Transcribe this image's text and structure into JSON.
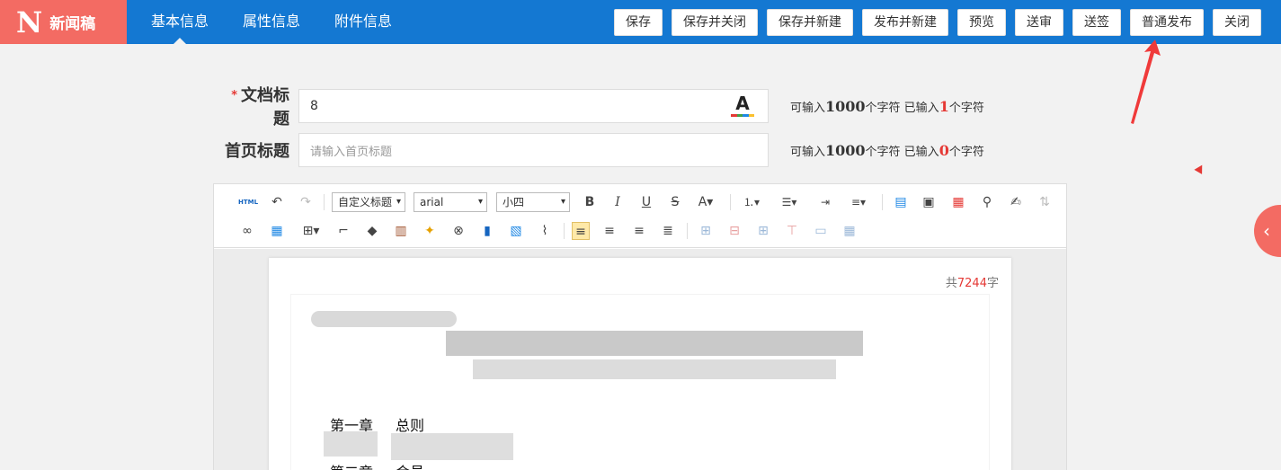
{
  "brand": {
    "logo": "N",
    "title": "新闻稿"
  },
  "tabs": [
    {
      "label": "基本信息",
      "active": true
    },
    {
      "label": "属性信息"
    },
    {
      "label": "附件信息"
    }
  ],
  "actions": [
    "保存",
    "保存并关闭",
    "保存并新建",
    "发布并新建",
    "预览",
    "送审",
    "送签",
    "普通发布",
    "关闭"
  ],
  "form": {
    "doc_title": {
      "label": "文档标题",
      "required_mark": "*",
      "value": "8",
      "hint_prefix": "可输入",
      "hint_max": "1000",
      "hint_mid": "个字符  已输入",
      "hint_count": "1",
      "hint_suffix": "个字符"
    },
    "home_title": {
      "label": "首页标题",
      "placeholder": "请输入首页标题",
      "hint_prefix": "可输入",
      "hint_max": "1000",
      "hint_mid": "个字符   已输入",
      "hint_count": "0",
      "hint_suffix": "个字符"
    }
  },
  "editor": {
    "html_label": "HTML",
    "heading_select": "自定义标题",
    "font_select": "arial",
    "size_select": "小四",
    "wordcount_prefix": "共",
    "wordcount": "7244",
    "wordcount_suffix": "字",
    "doc_lines": [
      {
        "chapter": "第一章",
        "title": "总则"
      },
      {
        "chapter": "第二章",
        "title": "会员"
      }
    ]
  },
  "colors": {
    "topbar": "#1478d2",
    "brand": "#f36b63",
    "accent_red": "#e53935"
  },
  "icons": [
    "undo-icon",
    "redo-icon",
    "bold-icon",
    "italic-icon",
    "underline-icon",
    "strikethrough-icon",
    "collapse-left-icon"
  ]
}
